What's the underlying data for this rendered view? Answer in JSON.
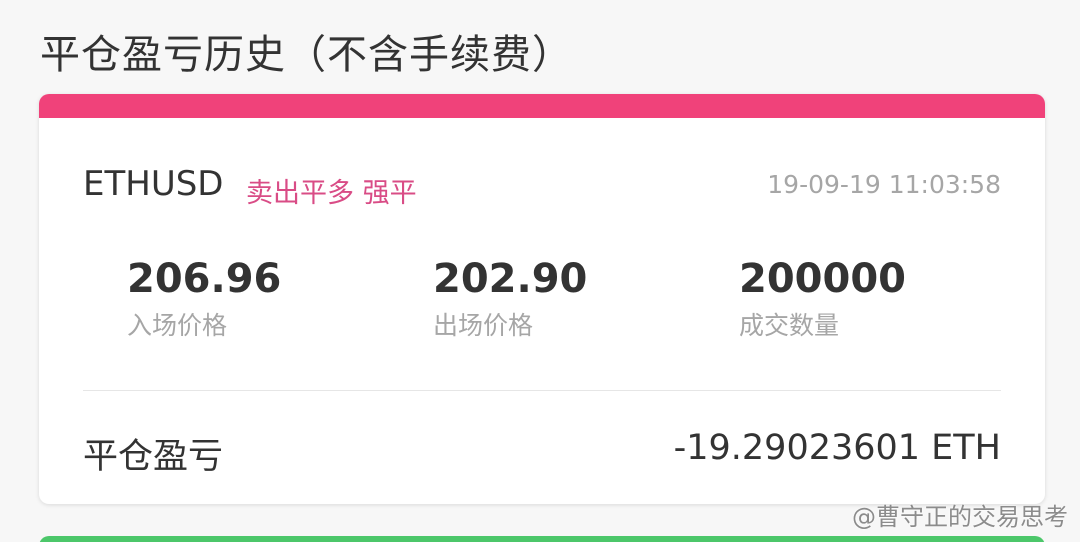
{
  "section": {
    "title": "平仓盈亏历史（不含手续费）"
  },
  "trade": {
    "symbol": "ETHUSD",
    "action": "卖出平多 强平",
    "timestamp": "19-09-19 11:03:58",
    "entry_price": {
      "value": "206.96",
      "label": "入场价格"
    },
    "exit_price": {
      "value": "202.90",
      "label": "出场价格"
    },
    "quantity": {
      "value": "200000",
      "label": "成交数量"
    },
    "pnl": {
      "label": "平仓盈亏",
      "value": "-19.29023601 ETH"
    }
  },
  "watermark": "@曹守正的交易思考",
  "colors": {
    "accent_stripe": "#f0427a",
    "action_tag": "#d94c86",
    "next_card_stripe": "#4cc76a"
  }
}
